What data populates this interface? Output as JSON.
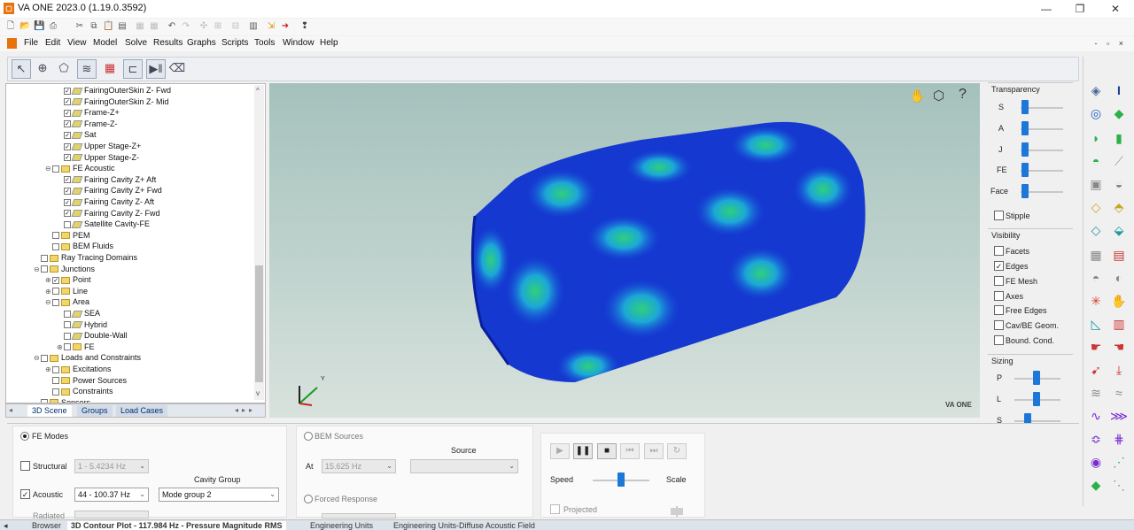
{
  "window": {
    "title": "VA ONE 2023.0 (1.19.0.3592)",
    "icon": "app-logo",
    "controls": [
      "minimize-icon",
      "maximize-icon",
      "close-icon"
    ]
  },
  "menu": [
    "File",
    "Edit",
    "View",
    "Model",
    "Solve",
    "Results",
    "Graphs",
    "Scripts",
    "Tools",
    "Window",
    "Help"
  ],
  "tree": {
    "rows": [
      {
        "label": "FairingOuterSkin Z- Fwd",
        "checked": true,
        "indent": 3
      },
      {
        "label": "FairingOuterSkin Z- Mid",
        "checked": true,
        "indent": 3
      },
      {
        "label": "Frame-Z+",
        "checked": true,
        "indent": 3
      },
      {
        "label": "Frame-Z-",
        "checked": true,
        "indent": 3
      },
      {
        "label": "Sat",
        "checked": true,
        "indent": 3
      },
      {
        "label": "Upper Stage-Z+",
        "checked": true,
        "indent": 3
      },
      {
        "label": "Upper Stage-Z-",
        "checked": true,
        "indent": 3
      },
      {
        "label": "FE Acoustic",
        "checked": false,
        "indent": 2,
        "expander": "⊖"
      },
      {
        "label": "Fairing Cavity Z+ Aft",
        "checked": true,
        "indent": 3
      },
      {
        "label": "Fairing Cavity Z+ Fwd",
        "checked": true,
        "indent": 3
      },
      {
        "label": "Fairing Cavity Z- Aft",
        "checked": true,
        "indent": 3
      },
      {
        "label": "Fairing Cavity Z- Fwd",
        "checked": true,
        "indent": 3
      },
      {
        "label": "Satellite Cavity-FE",
        "checked": false,
        "indent": 3
      },
      {
        "label": "PEM",
        "checked": false,
        "indent": 2
      },
      {
        "label": "BEM Fluids",
        "checked": false,
        "indent": 2
      },
      {
        "label": "Ray Tracing Domains",
        "checked": false,
        "indent": 1
      },
      {
        "label": "Junctions",
        "checked": false,
        "indent": 1,
        "expander": "⊖"
      },
      {
        "label": "Point",
        "checked": true,
        "indent": 2,
        "expander": "⊕"
      },
      {
        "label": "Line",
        "checked": false,
        "indent": 2,
        "expander": "⊕"
      },
      {
        "label": "Area",
        "checked": false,
        "indent": 2,
        "expander": "⊖"
      },
      {
        "label": "SEA",
        "checked": false,
        "indent": 3
      },
      {
        "label": "Hybrid",
        "checked": false,
        "indent": 3
      },
      {
        "label": "Double-Wall",
        "checked": false,
        "indent": 3
      },
      {
        "label": "FE",
        "checked": false,
        "indent": 3,
        "expander": "⊕"
      },
      {
        "label": "Loads and Constraints",
        "checked": false,
        "indent": 1,
        "expander": "⊖"
      },
      {
        "label": "Excitations",
        "checked": false,
        "indent": 2,
        "expander": "⊕"
      },
      {
        "label": "Power Sources",
        "checked": false,
        "indent": 2
      },
      {
        "label": "Constraints",
        "checked": false,
        "indent": 2
      },
      {
        "label": "Sensors",
        "checked": false,
        "indent": 1
      }
    ],
    "tabs": [
      "3D Scene",
      "Groups",
      "Load Cases"
    ]
  },
  "viewport": {
    "brand": "VA ONE",
    "help": "?",
    "triad_label": "Y"
  },
  "right_panel": {
    "transparency_title": "Transparency",
    "transparency": [
      {
        "label": "S",
        "value": 0.0
      },
      {
        "label": "A",
        "value": 0.0
      },
      {
        "label": "J",
        "value": 0.0
      },
      {
        "label": "FE",
        "value": 0.0
      },
      {
        "label": "Face",
        "value": 0.0
      }
    ],
    "stipple_label": "Stipple",
    "visibility_title": "Visibility",
    "visibility": [
      {
        "label": "Facets",
        "checked": false
      },
      {
        "label": "Edges",
        "checked": true
      },
      {
        "label": "FE Mesh",
        "checked": false
      },
      {
        "label": "Axes",
        "checked": false
      },
      {
        "label": "Free Edges",
        "checked": false
      },
      {
        "label": "Cav/BE Geom.",
        "checked": false
      },
      {
        "label": "Bound. Cond.",
        "checked": false
      }
    ],
    "sizing_title": "Sizing",
    "sizing": [
      {
        "label": "P",
        "value": 0.5
      },
      {
        "label": "L",
        "value": 0.5
      },
      {
        "label": "S",
        "value": 0.3
      }
    ]
  },
  "bottom": {
    "fe_modes_label": "FE Modes",
    "structural_label": "Structural",
    "structural_value": "1 - 5.4234 Hz",
    "acoustic_label": "Acoustic",
    "acoustic_value": "44 - 100.37 Hz",
    "cavity_group_label": "Cavity Group",
    "cavity_group_value": "Mode group 2",
    "radiated_label": "Radiated",
    "bem_sources_label": "BEM Sources",
    "source_label": "Source",
    "at_label": "At",
    "at_value": "15.625 Hz",
    "forced_response_label": "Forced Response",
    "speed_label": "Speed",
    "scale_label": "Scale",
    "projected_label": "Projected",
    "speed_value": 0.45
  },
  "status_tabs": [
    "Browser",
    "3D Contour Plot - 117.984 Hz - Pressure Magnitude RMS",
    "Engineering Units",
    "Engineering Units-Diffuse Acoustic Field"
  ]
}
